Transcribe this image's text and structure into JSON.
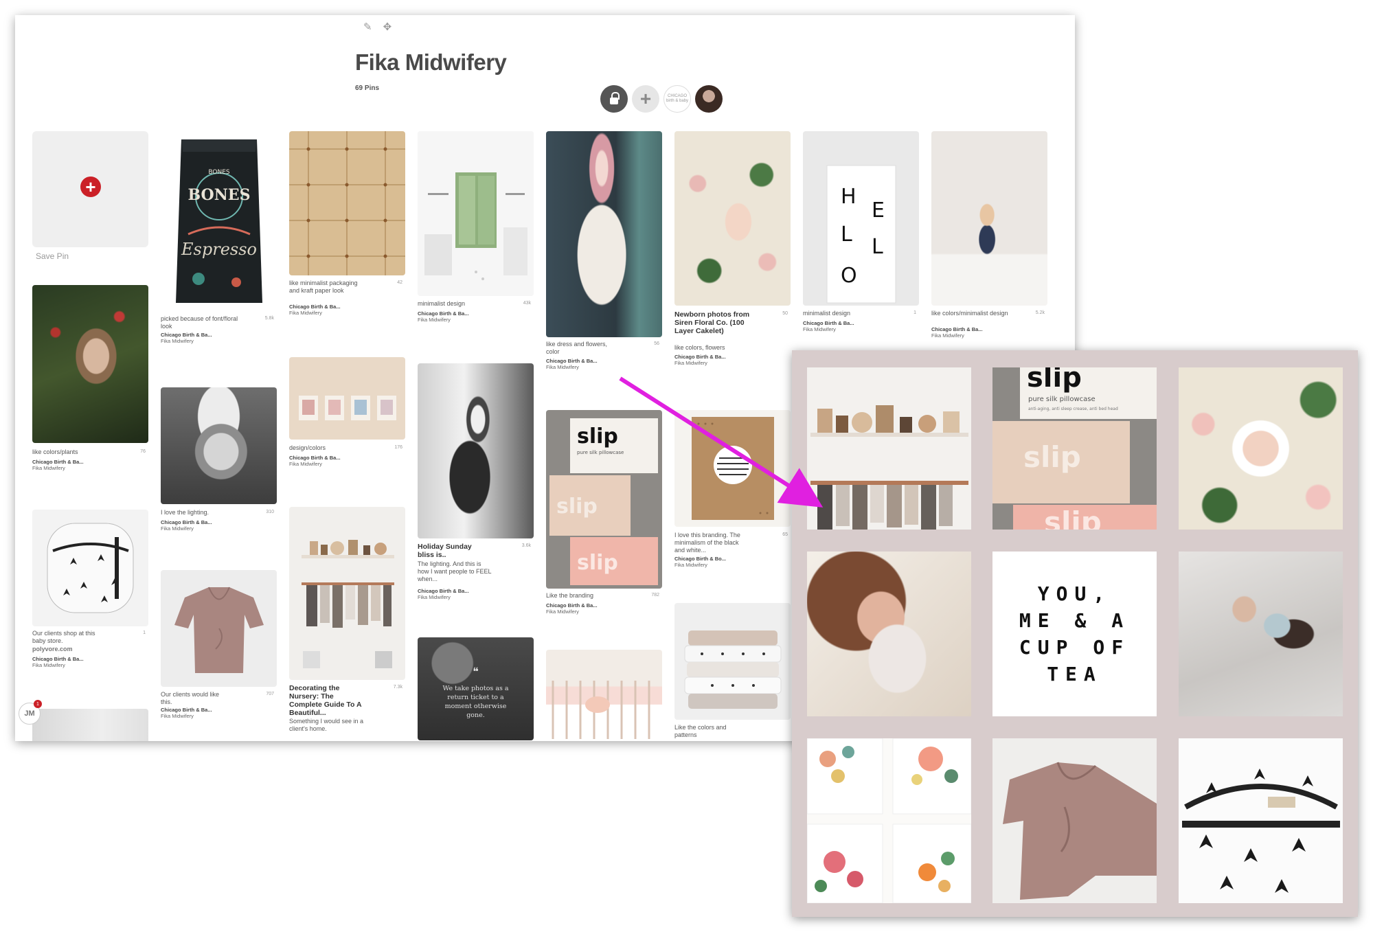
{
  "board": {
    "title": "Fika Midwifery",
    "pin_count": "69 Pins",
    "tools": {
      "edit_icon": "pencil-icon",
      "move_icon": "move-icon"
    },
    "collaborators": {
      "logo_text": "CHICAGO birth & baby"
    },
    "save_pin_label": "Save Pin",
    "user_initials": "JM",
    "notification_count": "1"
  },
  "pins": [
    {
      "desc": "like colors/plants",
      "count": "76",
      "attr_by": "Chicago Birth & Ba...",
      "attr_board": "Fika Midwifery"
    },
    {
      "desc": "Our clients shop at this baby store.",
      "count": "1",
      "source": "polyvore.com",
      "attr_by": "Chicago Birth & Ba...",
      "attr_board": "Fika Midwifery"
    },
    {
      "desc": "picked because of font/floral look",
      "count": "5.8k",
      "attr_by": "Chicago Birth & Ba...",
      "attr_board": "Fika Midwifery"
    },
    {
      "desc": "I love the lighting.",
      "count": "310",
      "attr_by": "Chicago Birth & Ba...",
      "attr_board": "Fika Midwifery"
    },
    {
      "desc": "Our clients would like this.",
      "count": "707",
      "attr_by": "Chicago Birth & Ba...",
      "attr_board": "Fika Midwifery"
    },
    {
      "desc": "like minimalist packaging and kraft paper look",
      "count": "42",
      "attr_by": "Chicago Birth & Ba...",
      "attr_board": "Fika Midwifery"
    },
    {
      "desc": "design/colors",
      "count": "176",
      "attr_by": "Chicago Birth & Ba...",
      "attr_board": "Fika Midwifery"
    },
    {
      "title": "Decorating the Nursery: The Complete Guide To A Beautiful...",
      "desc": "Something I would see in a client's home.",
      "count": "7.3k"
    },
    {
      "desc": "minimalist design",
      "count": "43k",
      "attr_by": "Chicago Birth & Ba...",
      "attr_board": "Fika Midwifery"
    },
    {
      "title": "Holiday Sunday bliss is..",
      "desc": "The lighting. And this is how I want people to FEEL when...",
      "count": "3.6k",
      "attr_by": "Chicago Birth & Ba...",
      "attr_board": "Fika Midwifery"
    },
    {
      "quote": "We take photos as a return ticket to a moment otherwise gone."
    },
    {
      "desc": "like dress and flowers, color",
      "count": "56",
      "attr_by": "Chicago Birth & Ba...",
      "attr_board": "Fika Midwifery"
    },
    {
      "desc": "Like the branding",
      "count": "782",
      "attr_by": "Chicago Birth & Ba...",
      "attr_board": "Fika Midwifery"
    },
    {
      "title": "Newborn photos from Siren Floral Co. (100 Layer Cakelet)",
      "desc": "like colors, flowers",
      "count": "50",
      "attr_by": "Chicago Birth & Ba...",
      "attr_board": "Fika Midwifery"
    },
    {
      "desc": "I love this branding. The minimalism of the black and white...",
      "count": "65",
      "attr_by": "Chicago Birth & Bo...",
      "attr_board": "Fika Midwifery"
    },
    {
      "desc": "Like the colors and patterns"
    },
    {
      "desc": "minimalist design",
      "count": "1",
      "attr_by": "Chicago Birth & Ba...",
      "attr_board": "Fika Midwifery"
    },
    {
      "desc": "like colors/minimalist design",
      "count": "5.2k",
      "attr_by": "Chicago Birth & Ba...",
      "attr_board": "Fika Midwifery"
    }
  ],
  "pin_text": {
    "slip": "slip",
    "slip_sub": "pure silk pillowcase",
    "hello": "HELLO"
  },
  "moodboard": {
    "quote": "YOU,\nME & A\nCUP OF\nTEA",
    "slip": "slip",
    "slip_sub": "pure silk pillowcase",
    "slip_sub2": "anti-aging, anti sleep crease, anti bed head"
  },
  "colors": {
    "pinterest_red": "#cb2027",
    "arrow": "#e020e0",
    "moodboard_bg": "#d8cccc"
  }
}
